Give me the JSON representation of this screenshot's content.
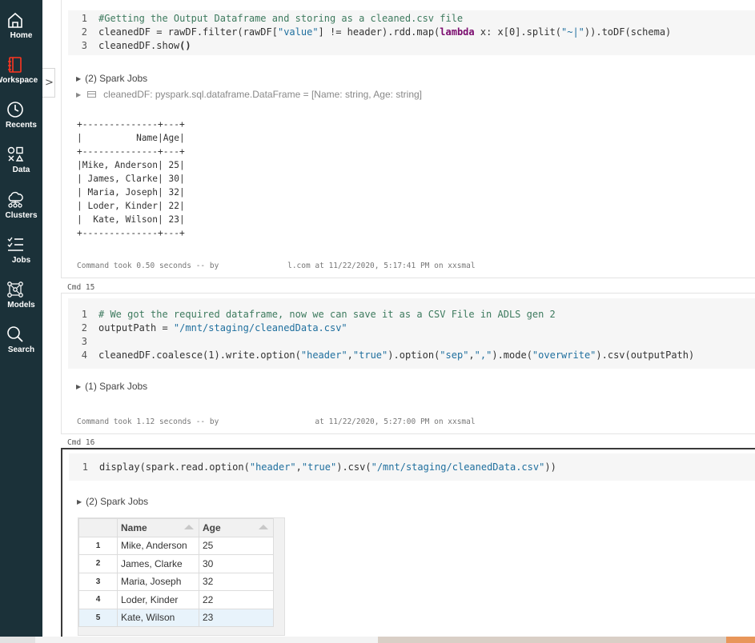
{
  "sidebar": {
    "items": [
      {
        "label": "Home",
        "icon": "home-icon"
      },
      {
        "label": "Workspace",
        "icon": "workspace-icon"
      },
      {
        "label": "Recents",
        "icon": "clock-icon"
      },
      {
        "label": "Data",
        "icon": "data-icon"
      },
      {
        "label": "Clusters",
        "icon": "cloud-icon"
      },
      {
        "label": "Jobs",
        "icon": "jobs-icon"
      },
      {
        "label": "Models",
        "icon": "models-icon"
      },
      {
        "label": "Search",
        "icon": "search-icon"
      }
    ],
    "collapse_glyph": ">",
    "accent_color": "#ff3621",
    "background_color": "#1b3139"
  },
  "cell14": {
    "code": [
      "#Getting the Output Dataframe and storing as a cleaned.csv file",
      "cleanedDF = rawDF.filter(rawDF[\"value\"] != header).rdd.map(lambda x: x[0].split(\"~|\")).toDF(schema)",
      "cleanedDF.show()"
    ],
    "line_numbers": [
      "1",
      "2",
      "3"
    ],
    "spark_jobs": "(2) Spark Jobs",
    "schema_line": "cleanedDF:  pyspark.sql.dataframe.DataFrame = [Name: string, Age: string]",
    "output": "+--------------+---+\n|          Name|Age|\n+--------------+---+\n|Mike, Anderson| 25|\n| James, Clarke| 30|\n| Maria, Joseph| 32|\n| Loder, Kinder| 22|\n|  Kate, Wilson| 23|\n+--------------+---+",
    "command_took": "Command took 0.50 seconds -- by               l.com at 11/22/2020, 5:17:41 PM on xxsmal"
  },
  "cell15": {
    "cmd_label": "Cmd 15",
    "code": [
      "# We got the required dataframe, now we can save it as a CSV File in ADLS gen 2",
      "outputPath = \"/mnt/staging/cleanedData.csv\"",
      "",
      "cleanedDF.coalesce(1).write.option(\"header\",\"true\").option(\"sep\",\",\").mode(\"overwrite\").csv(outputPath)"
    ],
    "line_numbers": [
      "1",
      "2",
      "3",
      "4"
    ],
    "spark_jobs": "(1) Spark Jobs",
    "command_took": "Command took 1.12 seconds -- by                     at 11/22/2020, 5:27:00 PM on xxsmal"
  },
  "cell16": {
    "cmd_label": "Cmd 16",
    "code": [
      "display(spark.read.option(\"header\",\"true\").csv(\"/mnt/staging/cleanedData.csv\"))"
    ],
    "line_numbers": [
      "1"
    ],
    "spark_jobs": "(2) Spark Jobs",
    "table": {
      "columns": [
        "Name",
        "Age"
      ],
      "rows": [
        {
          "idx": "1",
          "name": "Mike, Anderson",
          "age": "25"
        },
        {
          "idx": "2",
          "name": "James, Clarke",
          "age": "30"
        },
        {
          "idx": "3",
          "name": "Maria, Joseph",
          "age": "32"
        },
        {
          "idx": "4",
          "name": "Loder, Kinder",
          "age": "22"
        },
        {
          "idx": "5",
          "name": "Kate, Wilson",
          "age": "23"
        }
      ]
    }
  }
}
